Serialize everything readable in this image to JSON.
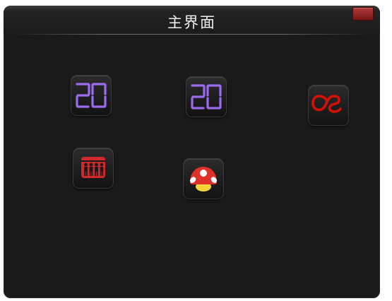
{
  "window": {
    "title": "主界面"
  },
  "desktop_icons": [
    {
      "icon": "digital-clock-20-icon",
      "text": "20",
      "color": "#9b6cf0"
    },
    {
      "icon": "digital-clock-20-icon",
      "text": "20",
      "color": "#9b6cf0"
    },
    {
      "icon": "lastfm-icon",
      "color": "#d51007"
    },
    {
      "icon": "people-group-icon",
      "color": "#d0282b"
    },
    {
      "icon": "mushroom-icon",
      "color": "#e0302a"
    }
  ]
}
